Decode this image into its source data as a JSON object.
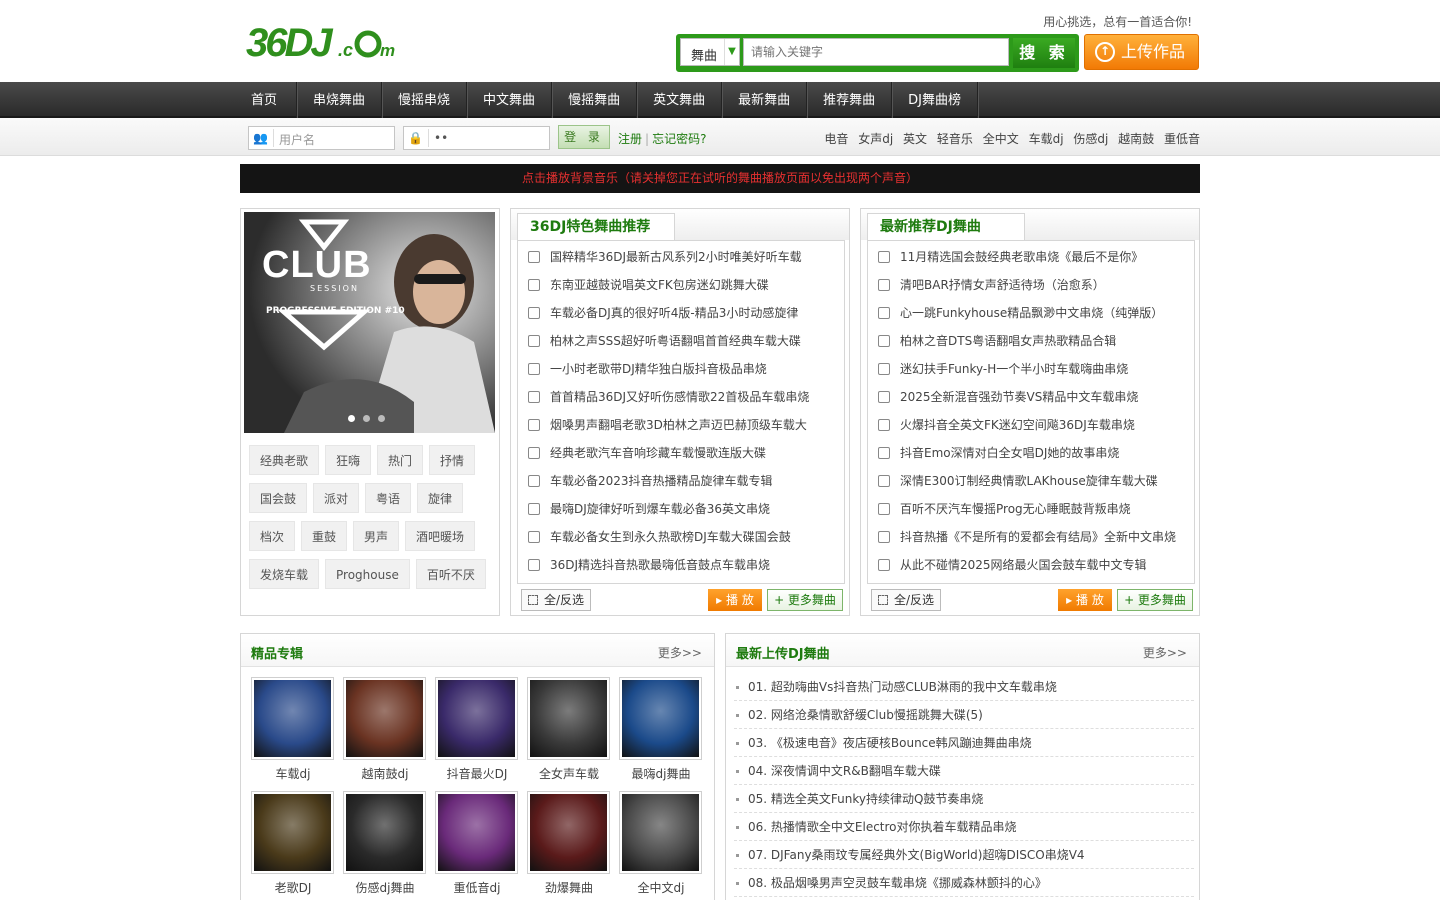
{
  "header": {
    "logo_text": "36DJ.com",
    "slogan": "用心挑选，总有一首适合你!",
    "search": {
      "category": "舞曲",
      "placeholder": "请输入关键字",
      "button": "搜 索"
    },
    "upload_button": "上传作品"
  },
  "nav": [
    "首页",
    "串烧舞曲",
    "慢摇串烧",
    "中文舞曲",
    "慢摇舞曲",
    "英文舞曲",
    "最新舞曲",
    "推荐舞曲",
    "DJ舞曲榜"
  ],
  "login": {
    "username_placeholder": "用户名",
    "password_value": "••",
    "login_button": "登 录",
    "register": "注册",
    "forgot": "忘记密码?"
  },
  "hot_tags": [
    "电音",
    "女声dj",
    "英文",
    "轻音乐",
    "全中文",
    "车载dj",
    "伤感dj",
    "越南鼓",
    "重低音"
  ],
  "notice": "点击播放背景音乐（请关掉您正在试听的舞曲播放页面以免出现两个声音）",
  "hero": {
    "title": "CLUB",
    "subtitle": "SESSION",
    "edition": "PROGRESSIVE EDITION #10",
    "slide_count": 3,
    "active_slide": 1
  },
  "tag_cloud": [
    "经典老歌",
    "狂嗨",
    "热门",
    "抒情",
    "国会鼓",
    "派对",
    "粤语",
    "旋律",
    "档次",
    "重鼓",
    "男声",
    "酒吧暖场",
    "发烧车载",
    "Proghouse",
    "百听不厌"
  ],
  "featured": {
    "title": "36DJ特色舞曲推荐",
    "items": [
      "国粹精华36DJ最新古风系列2小时唯美好听车载",
      "东南亚越鼓说唱英文FK包房迷幻跳舞大碟",
      "车载必备DJ真的很好听4版-精品3小时动感旋律",
      "柏林之声SSS超好听粤语翻唱首首经典车载大碟",
      "一小时老歌带DJ精华独白版抖音极品串烧",
      "首首精品36DJ又好听伤感情歌22首极品车载串烧",
      "烟嗓男声翻唱老歌3D柏林之声迈巴赫顶级车载大",
      "经典老歌汽车音响珍藏车载慢歌连版大碟",
      "车载必备2023抖音热播精品旋律车载专辑",
      "最嗨DJ旋律好听到爆车载必备36英文串烧",
      "车载必备女生到永久热歌榜DJ车载大碟国会鼓",
      "36DJ精选抖音热歌最嗨低音鼓点车载串烧"
    ],
    "select_all": "全/反选",
    "play": "播 放",
    "more": "+ 更多舞曲"
  },
  "recommended": {
    "title": "最新推荐DJ舞曲",
    "items": [
      "11月精选国会鼓经典老歌串烧《最后不是你》",
      "清吧BAR抒情女声舒适待场（治愈系）",
      "心一跳Funkyhouse精品飘渺中文串烧（纯弹版）",
      "柏林之音DTS粤语翻唱女声热歌精品合辑",
      "迷幻扶手Funky-H一个半小时车载嗨曲串烧",
      "2025全新混音强劲节奏VS精品中文车载串烧",
      "火爆抖音全英文FK迷幻空间飚36DJ车载串烧",
      "抖音Emo深情对白全女唱DJ她的故事串烧",
      "深情E300订制经典情歌LAKhouse旋律车载大碟",
      "百听不厌汽车慢摇Prog无心睡眠鼓背叛串烧",
      "抖音热播《不是所有的爱都会有结局》全新中文串烧",
      "从此不碰情2025网络最火国会鼓车载中文专辑"
    ],
    "select_all": "全/反选",
    "play": "播 放",
    "more": "+ 更多舞曲"
  },
  "albums": {
    "title": "精品专辑",
    "more": "更多>>",
    "items": [
      {
        "label": "车载dj",
        "color": "#2a4a8a"
      },
      {
        "label": "越南鼓dj",
        "color": "#6a3322"
      },
      {
        "label": "抖音最火DJ",
        "color": "#3a2a6a"
      },
      {
        "label": "全女声车载",
        "color": "#3a3a3a"
      },
      {
        "label": "最嗨dj舞曲",
        "color": "#1b4a8a"
      },
      {
        "label": "老歌DJ",
        "color": "#4a3a1a"
      },
      {
        "label": "伤感dj舞曲",
        "color": "#2a2a2a"
      },
      {
        "label": "重低音dj",
        "color": "#6a2a7a"
      },
      {
        "label": "劲爆舞曲",
        "color": "#5a1a1a"
      },
      {
        "label": "全中文dj",
        "color": "#4a4a4a"
      }
    ]
  },
  "newest": {
    "title": "最新上传DJ舞曲",
    "more": "更多>>",
    "items": [
      "01. 超劲嗨曲Vs抖音热门动感CLUB淋雨的我中文车载串烧",
      "02. 网络沧桑情歌舒缓Club慢摇跳舞大碟(5)",
      "03. 《极速电音》夜店硬核Bounce韩风蹦迪舞曲串烧",
      "04. 深夜情调中文R&B翻唱车载大碟",
      "05. 精选全英文Funky持续律动Q鼓节奏串烧",
      "06. 热播情歌全中文Electro对你执着车载精品串烧",
      "07. DJFany桑雨玟专属经典外文(BigWorld)超嗨DISCO串烧V4",
      "08. 极品烟嗓男声空灵鼓车载串烧《挪威森林颤抖的心》"
    ]
  },
  "colors": {
    "brand_green": "#1e7b0f",
    "accent_orange": "#f27a05",
    "notice_red": "#e53030"
  }
}
